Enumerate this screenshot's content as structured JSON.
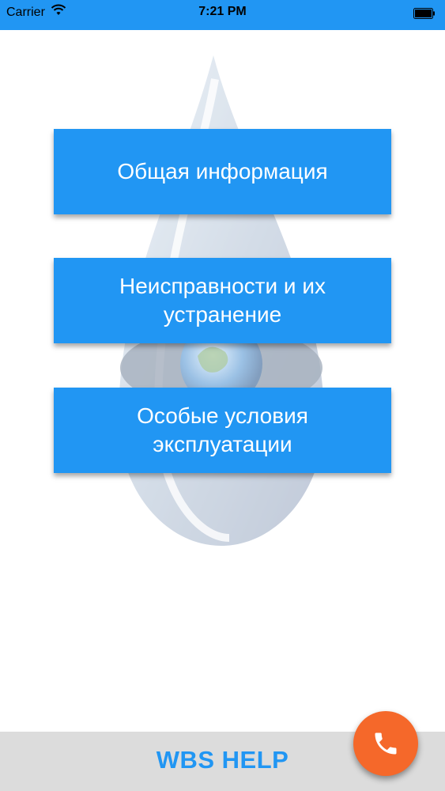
{
  "status_bar": {
    "carrier": "Carrier",
    "time": "7:21 PM",
    "icons": [
      "wifi-icon",
      "battery-icon"
    ]
  },
  "menu": {
    "items": [
      {
        "label": "Общая информация"
      },
      {
        "label": "Неисправности и их устранение"
      },
      {
        "label": "Особые условия эксплуатации"
      }
    ]
  },
  "bottom_bar": {
    "title": "WBS HELP",
    "call_icon": "phone-icon"
  },
  "colors": {
    "accent": "#2196f3",
    "fab": "#f5682a",
    "bottom_bar": "#dcdcdc"
  }
}
